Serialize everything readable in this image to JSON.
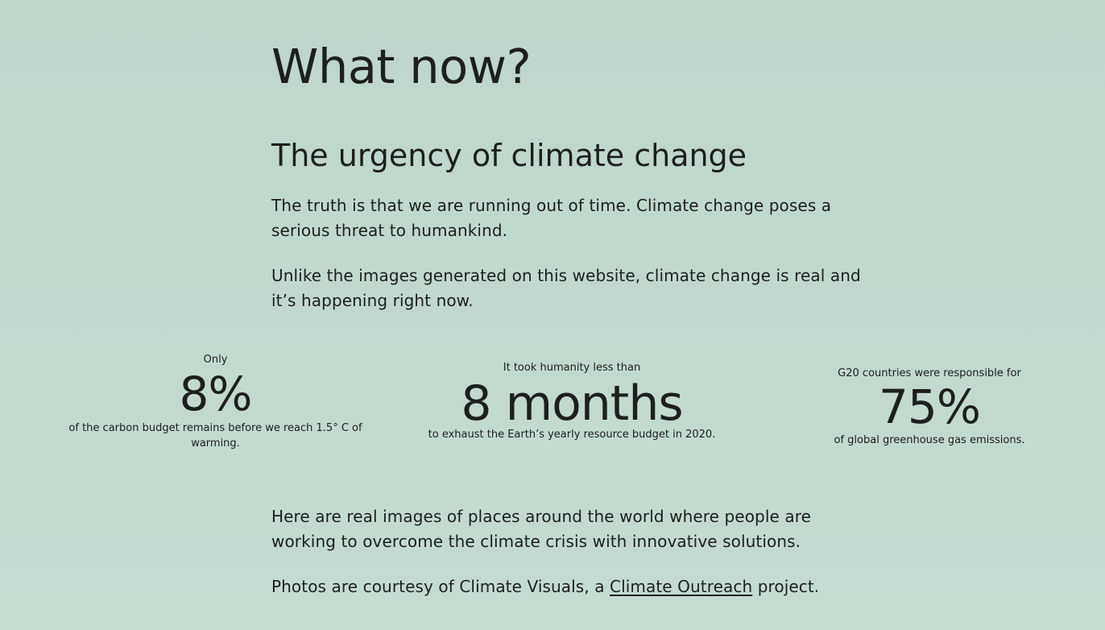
{
  "heading": "What now?",
  "subheading": "The urgency of climate change",
  "paragraphs": {
    "intro": "The truth is that we are running out of time. Climate change poses a serious threat to humankind.",
    "real": "Unlike the images generated on this website, climate change is real and it’s happening right now.",
    "solutions": "Here are real images of places around the world where people are working to overcome the climate crisis with innovative solutions.",
    "credit_before": "Photos are courtesy of Climate Visuals, a ",
    "credit_link": "Climate Outreach",
    "credit_after": " project."
  },
  "stats": [
    {
      "pre": "Only",
      "value": "8%",
      "post": "of the carbon budget remains before we reach 1.5° C of warming."
    },
    {
      "pre": "It took humanity less than",
      "value": "8 months",
      "post": "to exhaust the Earth’s yearly resource budget in 2020."
    },
    {
      "pre": "G20 countries were responsible for",
      "value": "75%",
      "post": "of global greenhouse gas emissions."
    }
  ],
  "colors": {
    "background": "#c2d8cd",
    "text": "#1d1f1e"
  }
}
